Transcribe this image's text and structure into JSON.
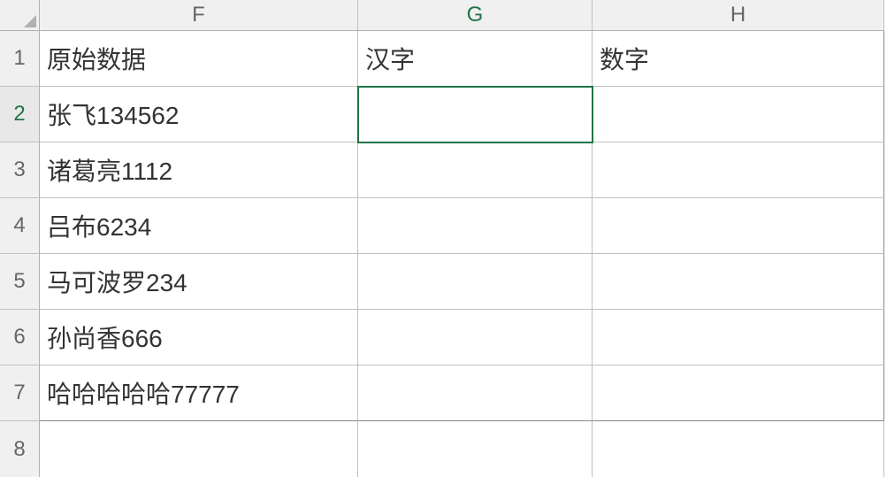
{
  "columns": {
    "F": "F",
    "G": "G",
    "H": "H"
  },
  "rows": [
    "1",
    "2",
    "3",
    "4",
    "5",
    "6",
    "7",
    "8"
  ],
  "active_cell": "G2",
  "chart_data": {
    "type": "table",
    "headers": [
      "原始数据",
      "汉字",
      "数字"
    ],
    "rows": [
      [
        "张飞134562",
        "",
        ""
      ],
      [
        "诸葛亮1112",
        "",
        ""
      ],
      [
        "吕布6234",
        "",
        ""
      ],
      [
        "马可波罗234",
        "",
        ""
      ],
      [
        "孙尚香666",
        "",
        ""
      ],
      [
        "哈哈哈哈哈77777",
        "",
        ""
      ]
    ]
  },
  "cells": {
    "F1": "原始数据",
    "G1": "汉字",
    "H1": "数字",
    "F2": "张飞134562",
    "G2": "",
    "H2": "",
    "F3": "诸葛亮1112",
    "G3": "",
    "H3": "",
    "F4": "吕布6234",
    "G4": "",
    "H4": "",
    "F5": "马可波罗234",
    "G5": "",
    "H5": "",
    "F6": "孙尚香666",
    "G6": "",
    "H6": "",
    "F7": "哈哈哈哈哈77777",
    "G7": "",
    "H7": "",
    "F8": "",
    "G8": "",
    "H8": ""
  }
}
